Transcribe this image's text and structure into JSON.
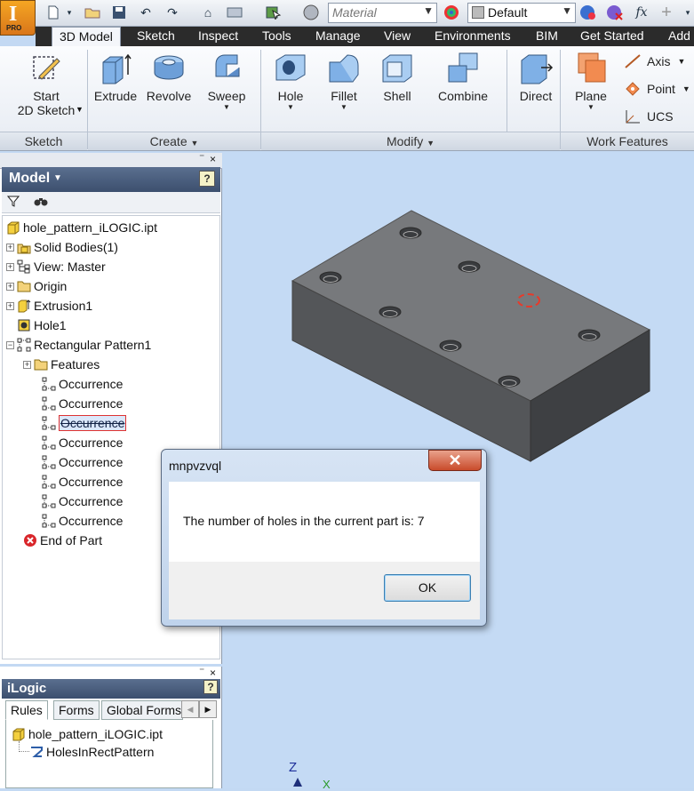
{
  "app": {
    "logo_letter": "I",
    "edition": "PRO"
  },
  "qat": {
    "material_placeholder": "Material",
    "appearance_value": "Default"
  },
  "ribbon": {
    "tabs": [
      "3D Model",
      "Sketch",
      "Inspect",
      "Tools",
      "Manage",
      "View",
      "Environments",
      "BIM",
      "Get Started",
      "Add"
    ],
    "active_tab": "3D Model",
    "buttons": {
      "start_sketch_line1": "Start",
      "start_sketch_line2": "2D Sketch",
      "extrude": "Extrude",
      "revolve": "Revolve",
      "sweep": "Sweep",
      "hole": "Hole",
      "fillet": "Fillet",
      "shell": "Shell",
      "combine": "Combine",
      "direct": "Direct",
      "plane": "Plane",
      "axis": "Axis",
      "point": "Point",
      "ucs": "UCS"
    },
    "groups": [
      "Sketch",
      "Create",
      "Modify",
      "Work Features"
    ]
  },
  "browser": {
    "title": "Model",
    "tree": [
      {
        "label": "hole_pattern_iLOGIC.ipt",
        "icon": "part-icon"
      },
      {
        "label": "Solid Bodies(1)",
        "icon": "solid-bodies-icon"
      },
      {
        "label": "View: Master",
        "icon": "view-icon"
      },
      {
        "label": "Origin",
        "icon": "folder-icon"
      },
      {
        "label": "Extrusion1",
        "icon": "extrusion-icon"
      },
      {
        "label": "Hole1",
        "icon": "hole-icon"
      },
      {
        "label": "Rectangular Pattern1",
        "icon": "pattern-icon"
      },
      {
        "label": "Features",
        "icon": "folder-icon"
      },
      {
        "label": "Occurrence",
        "icon": "occurrence-icon"
      },
      {
        "label": "Occurrence",
        "icon": "occurrence-icon"
      },
      {
        "label": "Occurrence",
        "icon": "occurrence-icon"
      },
      {
        "label": "Occurrence",
        "icon": "occurrence-icon"
      },
      {
        "label": "Occurrence",
        "icon": "occurrence-icon"
      },
      {
        "label": "Occurrence",
        "icon": "occurrence-icon"
      },
      {
        "label": "Occurrence",
        "icon": "occurrence-icon"
      },
      {
        "label": "Occurrence",
        "icon": "occurrence-icon"
      },
      {
        "label": "End of Part",
        "icon": "end-of-part-icon"
      }
    ]
  },
  "ilogic": {
    "title": "iLogic",
    "tabs": [
      "Rules",
      "Forms",
      "Global Forms"
    ],
    "tree": [
      "hole_pattern_iLOGIC.ipt",
      "HolesInRectPattern"
    ]
  },
  "dialog": {
    "title": "mnpvzvql",
    "message": "The number of holes in the current part is:  7",
    "ok_label": "OK"
  },
  "viewcube": {
    "z_label": "Z",
    "x_label": "X"
  }
}
